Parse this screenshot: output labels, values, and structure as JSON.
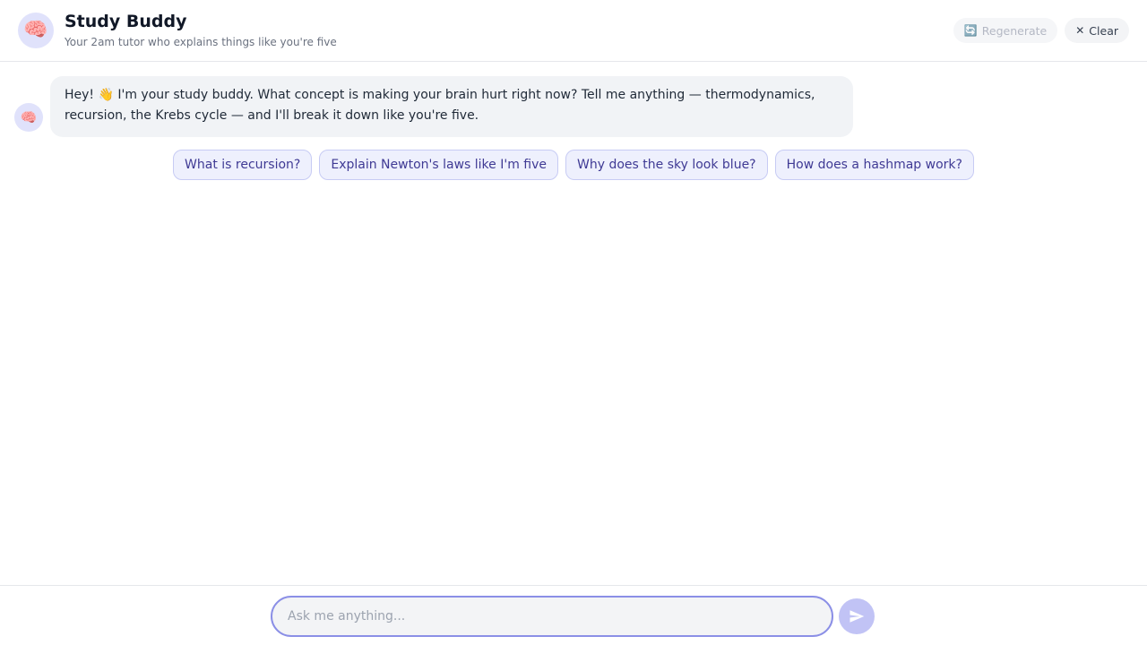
{
  "header": {
    "avatar_glyph": "🧠",
    "title": "Study Buddy",
    "subtitle": "Your 2am tutor who explains things like you're five",
    "regenerate": {
      "icon_glyph": "🔄",
      "label": "Regenerate",
      "disabled": true
    },
    "clear": {
      "icon_glyph": "✕",
      "label": "Clear"
    }
  },
  "messages": [
    {
      "role": "assistant",
      "avatar_glyph": "🧠",
      "text": "Hey! 👋 I'm your study buddy. What concept is making your brain hurt right now? Tell me anything — thermodynamics, recursion, the Krebs cycle — and I'll break it down like you're five."
    }
  ],
  "suggestions": [
    "What is recursion?",
    "Explain Newton's laws like I'm five",
    "Why does the sky look blue?",
    "How does a hashmap work?"
  ],
  "composer": {
    "placeholder": "Ask me anything...",
    "value": "",
    "send_icon": "send-icon"
  },
  "colors": {
    "accent": "#8b8fe6",
    "chip_bg": "#eef0fd",
    "chip_text": "#3f3a94",
    "send_bg": "#c1c3f5"
  }
}
